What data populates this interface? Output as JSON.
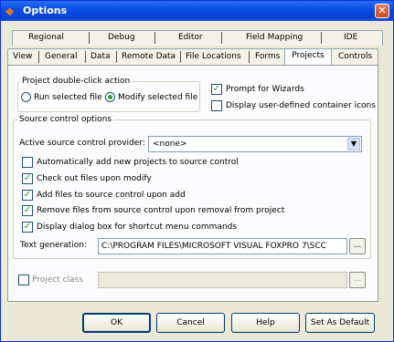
{
  "window": {
    "title": "Options",
    "icon": "fox-icon"
  },
  "tabs_row1": [
    "Regional",
    "Debug",
    "Editor",
    "Field Mapping",
    "IDE"
  ],
  "tabs_row2": [
    "View",
    "General",
    "Data",
    "Remote Data",
    "File Locations",
    "Forms",
    "Projects",
    "Controls"
  ],
  "active_tab": "Projects",
  "project_double_click": {
    "label": "Project double-click action",
    "options": [
      "Run selected file",
      "Modify selected file"
    ],
    "selected": "Modify selected file"
  },
  "prompt_wizards": {
    "label": "Prompt for Wizards",
    "checked": true
  },
  "display_icons": {
    "label": "Display user-defined container icons",
    "checked": false
  },
  "source_control": {
    "label": "Source control options",
    "provider_label": "Active source control provider:",
    "provider_value": "<none>",
    "checks": [
      {
        "label": "Automatically add new projects to source control",
        "checked": false
      },
      {
        "label": "Check out files upon modify",
        "checked": true
      },
      {
        "label": "Add files to source control upon add",
        "checked": true
      },
      {
        "label": "Remove files from source control upon removal from project",
        "checked": true
      },
      {
        "label": "Display dialog box for shortcut menu commands",
        "checked": true
      }
    ],
    "text_generation_label": "Text generation:",
    "text_generation_value": "C:\\PROGRAM FILES\\MICROSOFT VISUAL FOXPRO 7\\SCC",
    "ellipsis": "..."
  },
  "project_class": {
    "label": "Project class",
    "checked": false,
    "value": "",
    "ellipsis": "..."
  },
  "buttons": {
    "ok": "OK",
    "cancel": "Cancel",
    "help": "Help",
    "set_default": "Set As Default"
  },
  "close_glyph": "✕"
}
